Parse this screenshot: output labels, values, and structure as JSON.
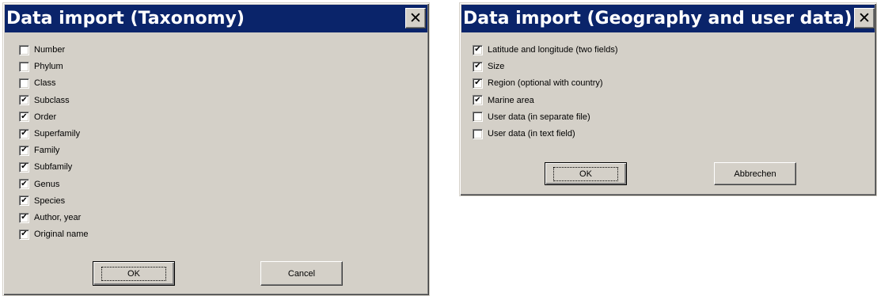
{
  "taxonomy_dialog": {
    "title": "Data import (Taxonomy)",
    "close_glyph": "✕",
    "options": [
      {
        "label": "Number",
        "checked": false
      },
      {
        "label": "Phylum",
        "checked": false
      },
      {
        "label": "Class",
        "checked": false
      },
      {
        "label": "Subclass",
        "checked": true
      },
      {
        "label": "Order",
        "checked": true
      },
      {
        "label": "Superfamily",
        "checked": true
      },
      {
        "label": "Family",
        "checked": true
      },
      {
        "label": "Subfamily",
        "checked": true
      },
      {
        "label": "Genus",
        "checked": true
      },
      {
        "label": "Species",
        "checked": true
      },
      {
        "label": "Author, year",
        "checked": true
      },
      {
        "label": "Original name",
        "checked": true
      }
    ],
    "ok_label": "OK",
    "cancel_label": "Cancel"
  },
  "geography_dialog": {
    "title": "Data import (Geography and user data)",
    "close_glyph": "✕",
    "options": [
      {
        "label": "Latitude and longitude (two fields)",
        "checked": true
      },
      {
        "label": "Size",
        "checked": true
      },
      {
        "label": "Region (optional with country)",
        "checked": true
      },
      {
        "label": "Marine area",
        "checked": true
      },
      {
        "label": "User data (in separate file)",
        "checked": false
      },
      {
        "label": "User data (in text field)",
        "checked": false
      }
    ],
    "ok_label": "OK",
    "cancel_label": "Abbrechen"
  },
  "check_glyph": "✔"
}
